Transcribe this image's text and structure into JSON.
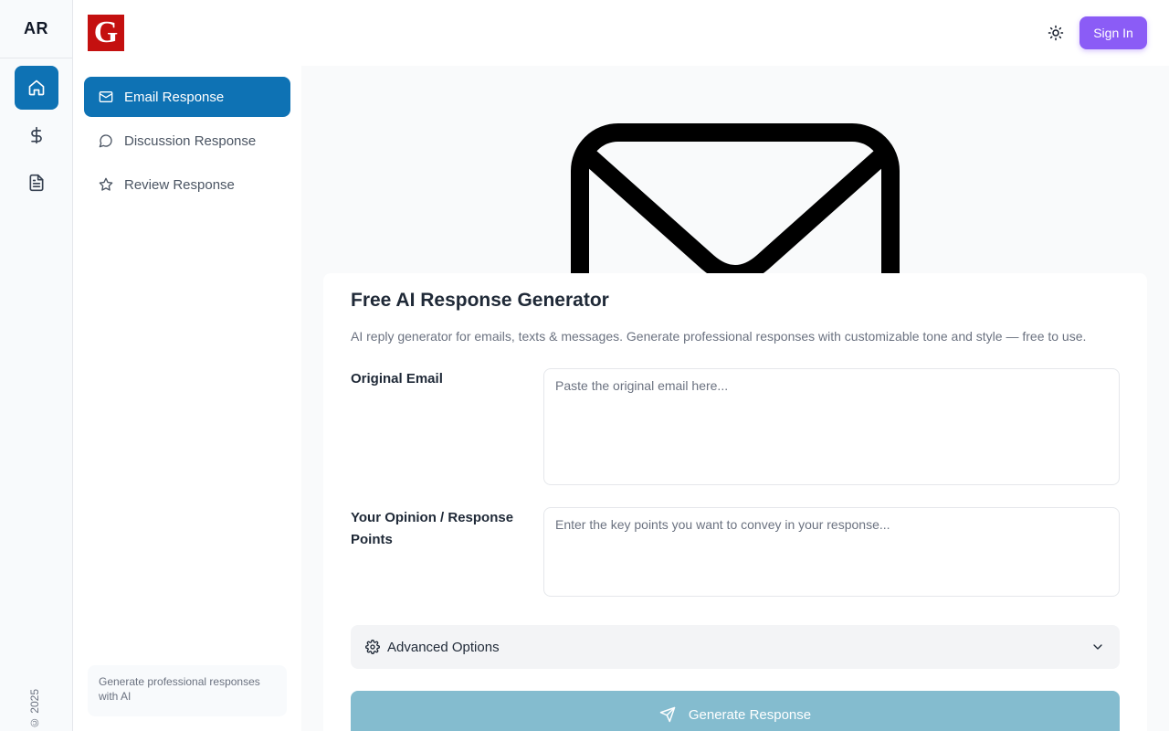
{
  "rail": {
    "brand": "AR",
    "items": [
      {
        "icon": "home-icon",
        "active": true
      },
      {
        "icon": "dollar-icon",
        "active": false
      },
      {
        "icon": "document-icon",
        "active": false
      }
    ],
    "copyright": "© 2025"
  },
  "header": {
    "logo_letter": "G",
    "theme_icon": "sun-icon",
    "signin_label": "Sign In"
  },
  "sidebar": {
    "items": [
      {
        "label": "Email Response",
        "icon": "mail-icon",
        "active": true
      },
      {
        "label": "Discussion Response",
        "icon": "chat-icon",
        "active": false
      },
      {
        "label": "Review Response",
        "icon": "star-icon",
        "active": false
      }
    ],
    "footer_text": "Generate professional responses with AI"
  },
  "main": {
    "hero_icon": "envelope-illustration",
    "title": "Free AI Response Generator",
    "subtitle": "AI reply generator for emails, texts & messages. Generate professional responses with customizable tone and style — free to use.",
    "original_email": {
      "label": "Original Email",
      "placeholder": "Paste the original email here...",
      "value": ""
    },
    "opinion": {
      "label": "Your Opinion / Response Points",
      "placeholder": "Enter the key points you want to convey in your response...",
      "value": ""
    },
    "advanced_label": "Advanced Options",
    "generate_label": "Generate Response"
  },
  "colors": {
    "accent": "#0e72b4",
    "signin": "#8b5cf6",
    "logo": "#c4100f",
    "generate_disabled": "#84bccf"
  }
}
